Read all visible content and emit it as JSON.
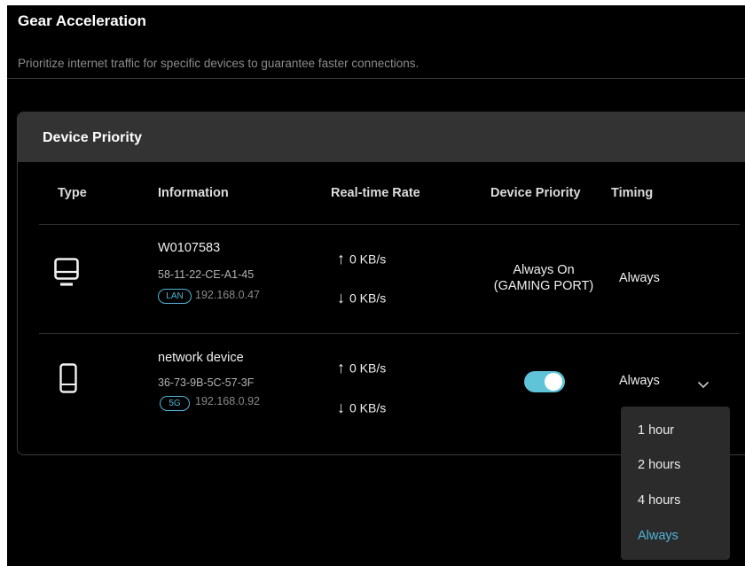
{
  "page": {
    "title": "Gear Acceleration",
    "description": "Prioritize internet traffic for specific devices to guarantee faster connections."
  },
  "card": {
    "title": "Device Priority",
    "columns": [
      "Type",
      "Information",
      "Real-time Rate",
      "Device Priority",
      "Timing"
    ]
  },
  "devices": [
    {
      "type_icon": "desktop-icon",
      "name": "W0107583",
      "mac": "58-11-22-CE-A1-45",
      "conn_badge": "LAN",
      "ip": "192.168.0.47",
      "upload": "0 KB/s",
      "download": "0 KB/s",
      "priority_text_1": "Always On",
      "priority_text_2": "(GAMING PORT)",
      "timing": "Always"
    },
    {
      "type_icon": "phone-icon",
      "name": "network device",
      "mac": "36-73-9B-5C-57-3F",
      "conn_badge": "5G",
      "ip": "192.168.0.92",
      "upload": "0 KB/s",
      "download": "0 KB/s",
      "priority_enabled": true,
      "timing": "Always"
    }
  ],
  "timing_dropdown": {
    "options": [
      "1 hour",
      "2 hours",
      "4 hours",
      "Always"
    ],
    "selected": "Always"
  },
  "icons": {
    "upload": "arrow-up-icon",
    "download": "arrow-down-icon",
    "dropdown": "chevron-down-icon"
  },
  "colors": {
    "accent": "#4fb5d8",
    "toggle_on": "#5fc4d8",
    "background": "#000000",
    "header_bg": "#333333"
  }
}
